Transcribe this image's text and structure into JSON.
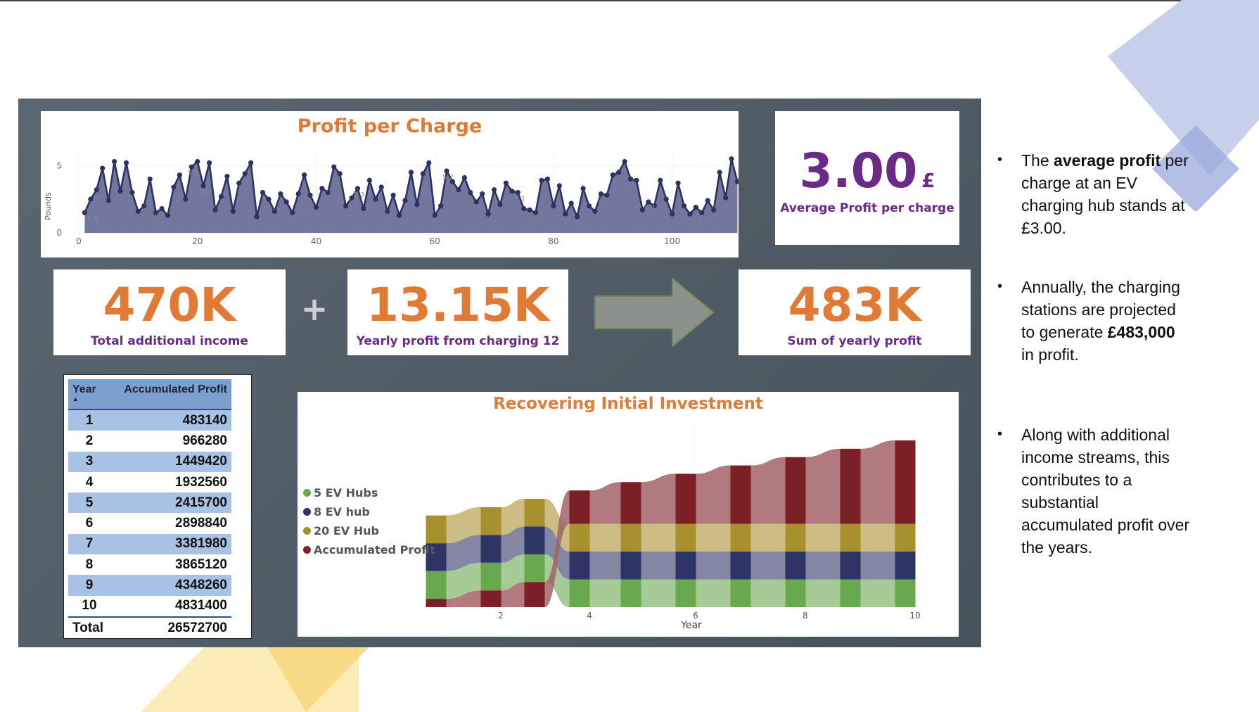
{
  "profit_chart": {
    "title": "Profit per Charge",
    "ylabel": "Pounds",
    "y_ticks": [
      "0",
      "5"
    ],
    "x_ticks": [
      "0",
      "20",
      "40",
      "60",
      "80",
      "100"
    ],
    "fill_color": "#6b6f98",
    "line_color": "#2d3260",
    "point_labels": [
      "1.5",
      "5.3",
      "5.2",
      "5.3",
      "5.2",
      "1.3",
      "1.3",
      "5.4",
      "5.5",
      "1.0"
    ]
  },
  "kpi_avg": {
    "value": "3.00",
    "unit": "£",
    "label": "Average Profit per charge"
  },
  "kpi_income": {
    "value": "470K",
    "label": "Total additional income"
  },
  "plus_symbol": "+",
  "kpi_yearly": {
    "value": "13.15K",
    "label": "Yearly profit from charging 12"
  },
  "kpi_sum": {
    "value": "483K",
    "label": "Sum of yearly profit"
  },
  "table": {
    "headers": {
      "year": "Year",
      "profit": "Accumulated Profit"
    },
    "rows": [
      {
        "year": "1",
        "value": "483140"
      },
      {
        "year": "2",
        "value": "966280"
      },
      {
        "year": "3",
        "value": "1449420"
      },
      {
        "year": "4",
        "value": "1932560"
      },
      {
        "year": "5",
        "value": "2415700"
      },
      {
        "year": "6",
        "value": "2898840"
      },
      {
        "year": "7",
        "value": "3381980"
      },
      {
        "year": "8",
        "value": "3865120"
      },
      {
        "year": "9",
        "value": "4348260"
      },
      {
        "year": "10",
        "value": "4831400"
      }
    ],
    "total_label": "Total",
    "total_value": "26572700"
  },
  "ribbon_chart": {
    "title": "Recovering Initial Investment",
    "xlabel": "Year",
    "x_ticks": [
      "2",
      "4",
      "6",
      "8",
      "10"
    ],
    "legend": [
      {
        "name": "5 EV Hubs",
        "color": "#6aa84f"
      },
      {
        "name": "8 EV hub",
        "color": "#2e3566"
      },
      {
        "name": "20 EV Hub",
        "color": "#a8902e"
      },
      {
        "name": "Accumulated Profit",
        "color": "#7a2026"
      }
    ]
  },
  "bullets": [
    {
      "pre": "The ",
      "bold": "average profit",
      "post": " per charge at an EV charging hub stands at £3.00."
    },
    {
      "pre": "Annually, the charging stations are projected to generate ",
      "bold": "£483,000",
      "post": " in profit."
    },
    {
      "pre": "Along with additional income streams, this contributes to a substantial accumulated profit over the years.",
      "bold": "",
      "post": ""
    }
  ],
  "chart_data": [
    {
      "type": "area",
      "title": "Profit per Charge",
      "ylabel": "Pounds",
      "x": [
        1,
        2,
        3,
        4,
        5,
        6,
        7,
        8,
        9,
        10,
        11,
        12,
        13,
        14,
        15,
        16,
        17,
        18,
        19,
        20,
        21,
        22,
        23,
        24,
        25,
        26,
        27,
        28,
        29,
        30,
        31,
        32,
        33,
        34,
        35,
        36,
        37,
        38,
        39,
        40,
        41,
        42,
        43,
        44,
        45,
        46,
        47,
        48,
        49,
        50,
        51,
        52,
        53,
        54,
        55,
        56,
        57,
        58,
        59,
        60,
        61,
        62,
        63,
        64,
        65,
        66,
        67,
        68,
        69,
        70,
        71,
        72,
        73,
        74,
        75,
        76,
        77,
        78,
        79,
        80,
        81,
        82,
        83,
        84,
        85,
        86,
        87,
        88,
        89,
        90,
        91,
        92,
        93,
        94,
        95,
        96,
        97,
        98,
        99,
        100,
        101,
        102,
        103,
        104,
        105,
        106,
        107,
        108,
        109,
        110,
        111
      ],
      "values": [
        1.5,
        2.5,
        3.2,
        4.8,
        2.4,
        5.3,
        3.1,
        5.2,
        3.0,
        1.6,
        2.0,
        4.0,
        1.5,
        1.8,
        1.3,
        3.4,
        4.3,
        2.5,
        4.9,
        5.3,
        3.5,
        5.2,
        1.7,
        2.7,
        4.2,
        1.6,
        3.7,
        4.4,
        5.2,
        1.2,
        3.0,
        2.5,
        1.6,
        2.9,
        2.3,
        1.5,
        2.9,
        4.3,
        2.8,
        1.9,
        3.3,
        3.0,
        4.9,
        4.4,
        2.0,
        2.6,
        3.3,
        1.8,
        3.9,
        2.5,
        3.4,
        1.6,
        2.8,
        1.3,
        2.4,
        4.5,
        2.1,
        4.4,
        5.2,
        1.3,
        2.0,
        4.6,
        3.8,
        3.2,
        4.1,
        3.0,
        2.3,
        2.9,
        1.4,
        3.2,
        2.1,
        3.7,
        3.1,
        3.0,
        1.8,
        1.7,
        1.5,
        3.9,
        4.0,
        2.0,
        3.5,
        1.4,
        2.2,
        1.2,
        3.3,
        2.0,
        1.6,
        2.9,
        2.8,
        4.3,
        4.5,
        5.3,
        4.0,
        3.9,
        1.7,
        2.3,
        2.0,
        3.9,
        2.5,
        1.4,
        3.7,
        2.0,
        1.4,
        1.9,
        1.5,
        2.4,
        1.7,
        4.5,
        2.6,
        5.5,
        3.8,
        5.4,
        1.0
      ],
      "xlim": [
        0,
        110
      ],
      "ylim": [
        0,
        5.8
      ],
      "y_ticks": [
        0,
        5
      ],
      "x_ticks": [
        0,
        20,
        40,
        60,
        80,
        100
      ]
    },
    {
      "type": "area",
      "title": "Recovering Initial Investment",
      "xlabel": "Year",
      "categories": [
        "1",
        "2",
        "3",
        "4",
        "5",
        "6",
        "7",
        "8",
        "9",
        "10"
      ],
      "series": [
        {
          "name": "5 EV Hubs",
          "values": [
            1,
            1,
            1,
            1,
            1,
            1,
            1,
            1,
            1,
            1
          ]
        },
        {
          "name": "8 EV hub",
          "values": [
            1,
            1,
            1,
            1,
            1,
            1,
            1,
            1,
            1,
            1
          ]
        },
        {
          "name": "20 EV Hub",
          "values": [
            1,
            1,
            1,
            1,
            1,
            1,
            1,
            1,
            1,
            1
          ]
        },
        {
          "name": "Accumulated Profit",
          "values": [
            0.3,
            0.6,
            0.9,
            1.2,
            1.5,
            1.8,
            2.1,
            2.4,
            2.7,
            3.0
          ]
        }
      ]
    }
  ]
}
